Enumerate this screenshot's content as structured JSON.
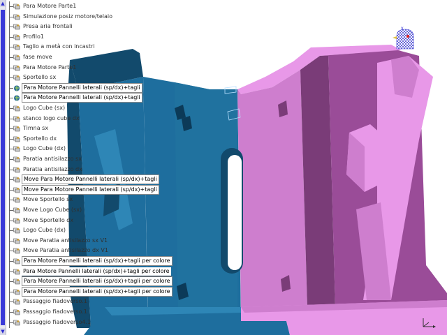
{
  "tree_items": [
    {
      "label": "Para Motore Parte1",
      "icon": "part-icon",
      "highlight": ""
    },
    {
      "label": "Simulazione posiz motore/telaio",
      "icon": "part-icon",
      "highlight": ""
    },
    {
      "label": "Presa aria frontali",
      "icon": "part-icon",
      "highlight": ""
    },
    {
      "label": "Profilo1",
      "icon": "part-icon",
      "highlight": ""
    },
    {
      "label": "Taglio a metà con incastri",
      "icon": "part-icon",
      "highlight": ""
    },
    {
      "label": "fase move",
      "icon": "part-icon",
      "highlight": ""
    },
    {
      "label": "Para Motore Parte1",
      "icon": "part-icon",
      "highlight": ""
    },
    {
      "label": "Sportello sx",
      "icon": "part-icon",
      "highlight": ""
    },
    {
      "label": "Para Motore Pannelli laterali (sp/dx)+tagli",
      "icon": "product-icon",
      "highlight": "box"
    },
    {
      "label": "Para Motore Pannelli laterali (sp/dx)+tagli",
      "icon": "product-icon",
      "highlight": "box"
    },
    {
      "label": "Logo Cube (sx)",
      "icon": "part-icon",
      "highlight": ""
    },
    {
      "label": "stanco logo cube dx",
      "icon": "part-icon",
      "highlight": ""
    },
    {
      "label": "Timna sx",
      "icon": "part-icon",
      "highlight": ""
    },
    {
      "label": "Sportello dx",
      "icon": "part-icon",
      "highlight": ""
    },
    {
      "label": "Logo Cube (dx)",
      "icon": "part-icon",
      "highlight": ""
    },
    {
      "label": "Paratia antisilazzo sx",
      "icon": "part-icon",
      "highlight": ""
    },
    {
      "label": "Paratia antisilazzo dx",
      "icon": "part-icon",
      "highlight": ""
    },
    {
      "label": "Move Para Motore Pannelli laterali (sp/dx)+tagli",
      "icon": "part-icon",
      "highlight": "box"
    },
    {
      "label": "Move Para Motore Pannelli laterali (sp/dx)+tagli",
      "icon": "part-icon",
      "highlight": "box"
    },
    {
      "label": "Move Sportello sx",
      "icon": "part-icon",
      "highlight": ""
    },
    {
      "label": "Move Logo Cube (sx)",
      "icon": "part-icon",
      "highlight": ""
    },
    {
      "label": "Move Sportello dx",
      "icon": "part-icon",
      "highlight": ""
    },
    {
      "label": "Logo Cube (dx)",
      "icon": "part-icon",
      "highlight": ""
    },
    {
      "label": "Move Paratia antisilazzo sx V1",
      "icon": "part-icon",
      "highlight": ""
    },
    {
      "label": "Move Paratia antisilazzo dx V1",
      "icon": "part-icon",
      "highlight": ""
    },
    {
      "label": "Para Motore Pannelli laterali (sp/dx)+tagli per colore",
      "icon": "part-icon",
      "highlight": "box"
    },
    {
      "label": "Para Motore Pannelli laterali (sp/dx)+tagli per colore",
      "icon": "part-icon",
      "highlight": "dark"
    },
    {
      "label": "Para Motore Pannelli laterali (sp/dx)+tagli per colore",
      "icon": "part-icon",
      "highlight": "box"
    },
    {
      "label": "Para Motore Pannelli laterali (sp/dx)+tagli per colore",
      "icon": "part-icon",
      "highlight": "box"
    },
    {
      "label": "Passaggio fiadoverso.1",
      "icon": "part-icon",
      "highlight": ""
    },
    {
      "label": "Passaggio fiadoverso.1",
      "icon": "part-icon",
      "highlight": ""
    },
    {
      "label": "Passaggio fiadoverso4.1",
      "icon": "part-icon",
      "highlight": ""
    }
  ],
  "colors": {
    "blue_face": "#1e6e9e",
    "blue_dark": "#124a6c",
    "blue_light": "#2e86b6",
    "pink_face": "#ce7ece",
    "pink_dark": "#7a3c78",
    "pink_light": "#e898e8",
    "accent": "#2a2ad0"
  },
  "compass_label": "y"
}
